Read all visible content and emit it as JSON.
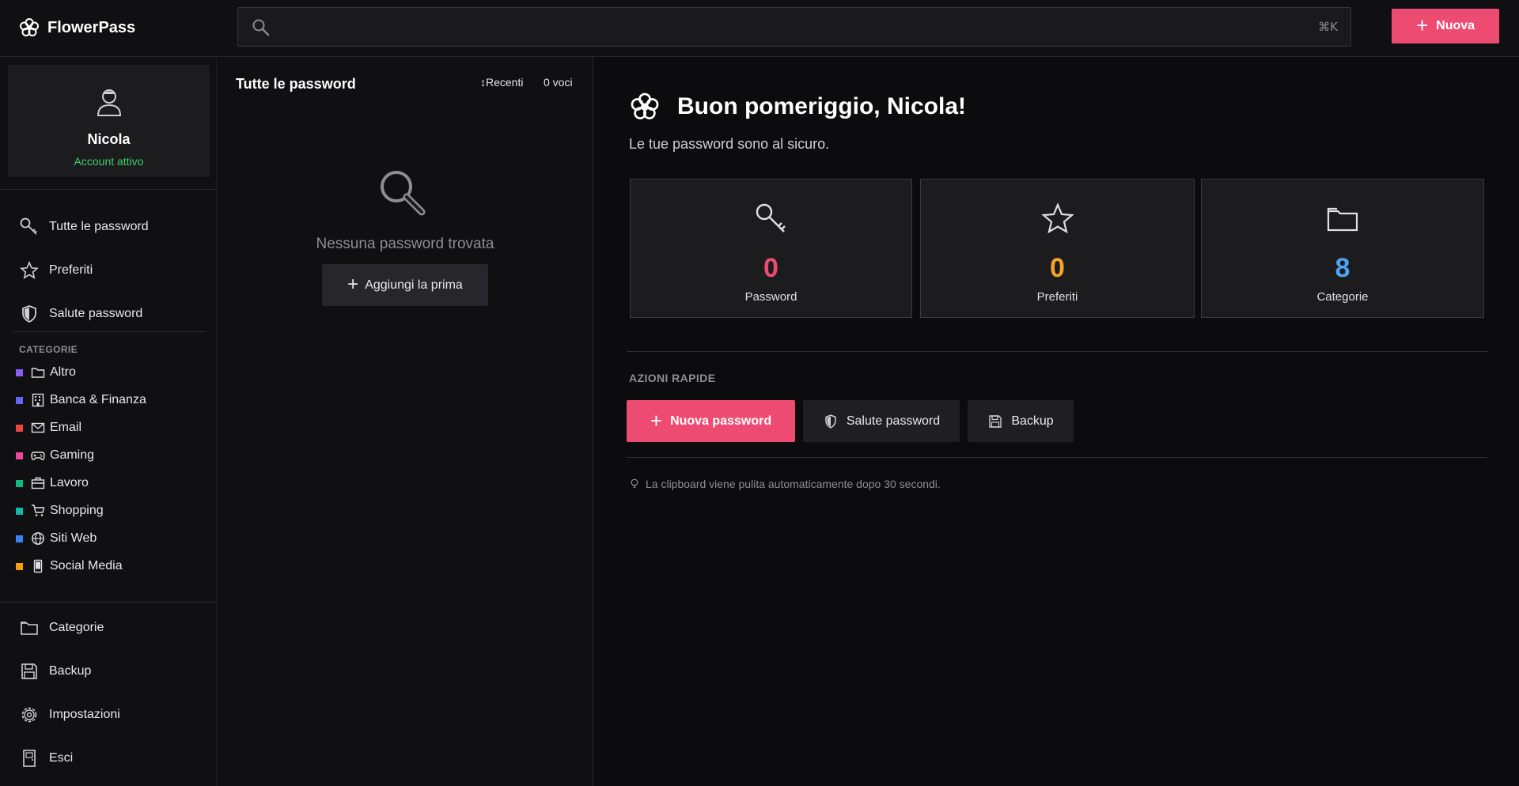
{
  "app": {
    "name": "FlowerPass"
  },
  "search": {
    "placeholder": "",
    "shortcut": "⌘K"
  },
  "header": {
    "new_button": "Nuova"
  },
  "profile": {
    "name": "Nicola",
    "status": "Account attivo"
  },
  "sidebar": {
    "nav": [
      {
        "label": "Tutte le password",
        "icon": "key-icon"
      },
      {
        "label": "Preferiti",
        "icon": "star-icon"
      },
      {
        "label": "Salute password",
        "icon": "shield-icon"
      }
    ],
    "categories_title": "CATEGORIE",
    "categories": [
      {
        "label": "Altro",
        "color": "#8b5cf6",
        "icon": "folder-icon"
      },
      {
        "label": "Banca & Finanza",
        "color": "#6366f1",
        "icon": "bank-icon"
      },
      {
        "label": "Email",
        "color": "#ef4444",
        "icon": "email-icon"
      },
      {
        "label": "Gaming",
        "color": "#ec4899",
        "icon": "gamepad-icon"
      },
      {
        "label": "Lavoro",
        "color": "#10b981",
        "icon": "briefcase-icon"
      },
      {
        "label": "Shopping",
        "color": "#14b8a6",
        "icon": "cart-icon"
      },
      {
        "label": "Siti Web",
        "color": "#3b82f6",
        "icon": "globe-icon"
      },
      {
        "label": "Social Media",
        "color": "#f59e0b",
        "icon": "phone-icon"
      }
    ],
    "bottom": [
      {
        "label": "Categorie",
        "icon": "folder-icon"
      },
      {
        "label": "Backup",
        "icon": "save-icon"
      },
      {
        "label": "Impostazioni",
        "icon": "gear-icon"
      },
      {
        "label": "Esci",
        "icon": "door-icon"
      }
    ]
  },
  "list": {
    "title": "Tutte le password",
    "sort": "↕Recenti",
    "count": "0 voci",
    "empty_text": "Nessuna password trovata",
    "add_first": "Aggiungi la prima"
  },
  "main": {
    "greeting": "Buon pomeriggio, Nicola!",
    "subtitle": "Le tue password sono al sicuro.",
    "stats": [
      {
        "value": "0",
        "label": "Password",
        "color": "#ee4b72",
        "icon": "key-icon"
      },
      {
        "value": "0",
        "label": "Preferiti",
        "color": "#f5a524",
        "icon": "star-icon"
      },
      {
        "value": "8",
        "label": "Categorie",
        "color": "#4ea3f1",
        "icon": "folder-icon"
      }
    ],
    "quick_actions_title": "AZIONI RAPIDE",
    "quick_actions": [
      {
        "label": "Nuova password"
      },
      {
        "label": "Salute password"
      },
      {
        "label": "Backup"
      }
    ],
    "tip": "La clipboard viene pulita automaticamente dopo 30 secondi."
  }
}
